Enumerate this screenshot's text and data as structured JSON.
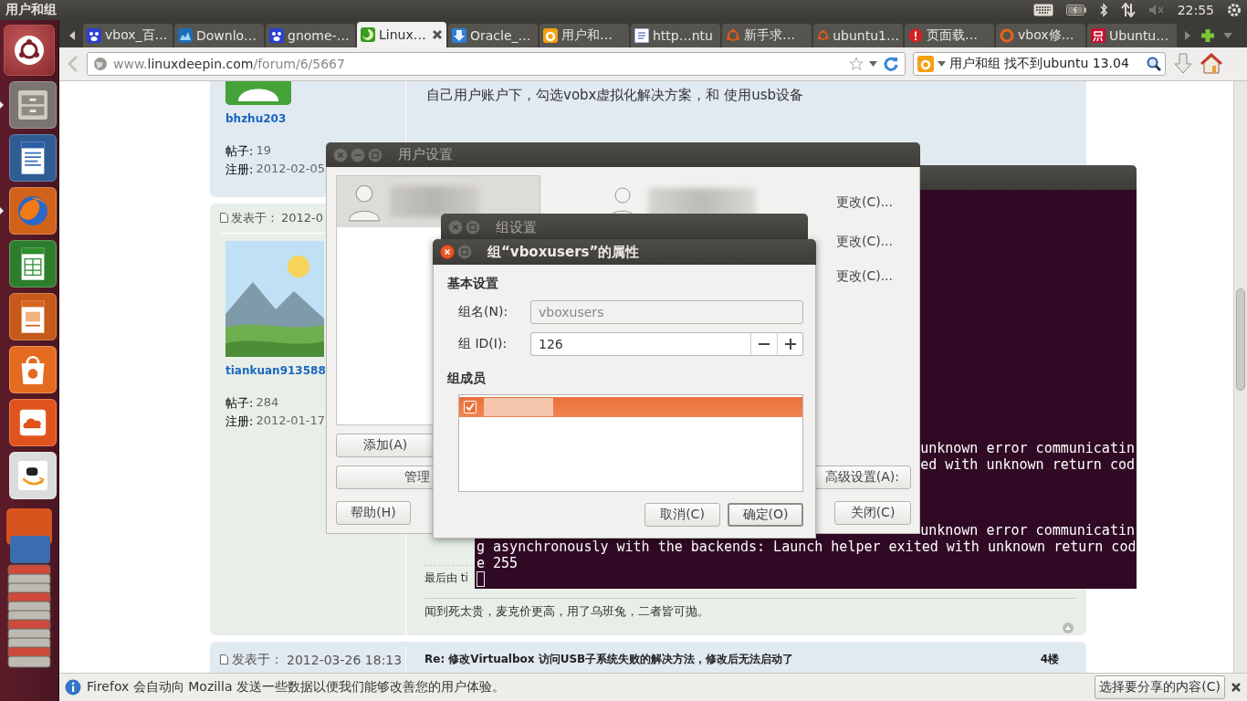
{
  "top_panel": {
    "title": "用户和组",
    "clock": "22:55"
  },
  "launcher": {
    "items": [
      {
        "running": true
      },
      {
        "running": false
      },
      {
        "running": true
      },
      {
        "running": false
      },
      {
        "running": false
      },
      {
        "running": false
      },
      {
        "running": false
      },
      {
        "running": false
      }
    ]
  },
  "browser": {
    "tabs": [
      {
        "label": "vbox_百…",
        "selected": false
      },
      {
        "label": "Downlo…",
        "selected": false
      },
      {
        "label": "gnome-…",
        "selected": false
      },
      {
        "label": "Linux…",
        "selected": true
      },
      {
        "label": "Oracle_…",
        "selected": false
      },
      {
        "label": "用户和…",
        "selected": false
      },
      {
        "label": "http…ntu",
        "selected": false
      },
      {
        "label": "新手求…",
        "selected": false
      },
      {
        "label": "ubuntu1…",
        "selected": false
      },
      {
        "label": "页面载…",
        "selected": false
      },
      {
        "label": "vbox修…",
        "selected": false
      },
      {
        "label": "Ubuntu…",
        "selected": false
      }
    ],
    "url": {
      "prefix": "www.",
      "domain": "linuxdeepin.com",
      "path": "/forum/6/5667"
    },
    "search": {
      "value": "用户和组 找不到ubuntu 13.04"
    }
  },
  "forum": {
    "posts": [
      {
        "author": "bhzhu203",
        "stats": [
          {
            "label": "帖子:",
            "value": "19"
          },
          {
            "label": "注册:",
            "value": "2012-02-05"
          }
        ],
        "body": "自己用户账户下，勾选vobx虚拟化解决方案，和 使用usb设备"
      },
      {
        "posted_label": "发表于：",
        "posted": "2012-0",
        "author": "tiankuan913588",
        "stats": [
          {
            "label": "帖子:",
            "value": "284"
          },
          {
            "label": "注册:",
            "value": "2012-01-17"
          }
        ],
        "edit_note": "最后由 ti",
        "signature": "闻到死太贵，麦克价更高，用了乌班兔，二者皆可抛。"
      },
      {
        "posted_label": "发表于：",
        "posted": "2012-03-26 18:13",
        "title": "Re: 修改Virtualbox 访问USB子系统失败的解决方法，修改后无法启动了",
        "floor": "4楼"
      }
    ]
  },
  "notification": {
    "message": "Firefox 会自动向 Mozilla 发送一些数据以便我们能够改善您的用户体验。",
    "button": "选择要分享的内容(C)"
  },
  "terminal": {
    "blocks": [
      {
        "lines": [
          {
            "kind": "tail",
            "text": "unknown error communicatin"
          },
          {
            "kind": "tail",
            "text": "ed with unknown return cod"
          }
        ]
      },
      {
        "lines": [
          {
            "kind": "tail",
            "text": "unknown error communicatin"
          },
          {
            "kind": "full",
            "text": "g asynchronously with the backends: Launch helper exited with unknown return cod"
          },
          {
            "kind": "full",
            "text": "e 255"
          }
        ]
      }
    ]
  },
  "user_settings": {
    "title": "用户设置",
    "users": [
      {
        "selected": true
      }
    ],
    "change_links": [
      "更改(C)...",
      "更改(C)...",
      "更改(C)..."
    ],
    "add_button": "添加(A)",
    "manage_button": "管理",
    "advanced_button": "高级设置(A):",
    "help_button": "帮助(H)",
    "close_button": "关闭(C)"
  },
  "group_settings": {
    "title": "组设置"
  },
  "group_properties": {
    "title": "组“vboxusers”的属性",
    "basic_heading": "基本设置",
    "name_label": "组名(N):",
    "name_field": {
      "value": "vboxusers",
      "disabled": true
    },
    "id_label": "组 ID(I):",
    "id_field": {
      "value": "126"
    },
    "members_heading": "组成员",
    "members": [
      {
        "checked": true,
        "selected": true
      }
    ],
    "buttons": [
      {
        "label": "取消(C)",
        "default": false
      },
      {
        "label": "确定(O)",
        "default": true
      }
    ]
  }
}
